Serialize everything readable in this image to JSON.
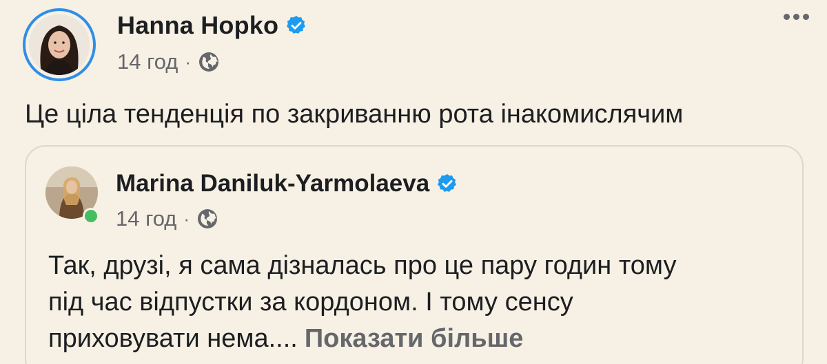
{
  "post": {
    "author": "Hanna Hopko",
    "time": "14 год",
    "separator": "·",
    "text": "Це ціла тенденція по закриванню рота інакомислячим"
  },
  "shared": {
    "author": "Marina Daniluk-Yarmolaeva",
    "time": "14 год",
    "separator": "·",
    "text_lines": [
      "Так, друзі, я сама дізналась про це пару годин тому",
      "під час відпустки за кордоном. І тому сенсу",
      "приховувати нема...."
    ],
    "see_more": "Показати більше"
  },
  "icons": {
    "verified": "verified-badge-icon",
    "globe": "globe-icon",
    "more": "more-options-icon"
  },
  "colors": {
    "background": "#f7f0e4",
    "verified": "#1d9bf0",
    "avatar_ring": "#2f8ee6",
    "online": "#45bd62",
    "secondary_text": "#65676b"
  }
}
